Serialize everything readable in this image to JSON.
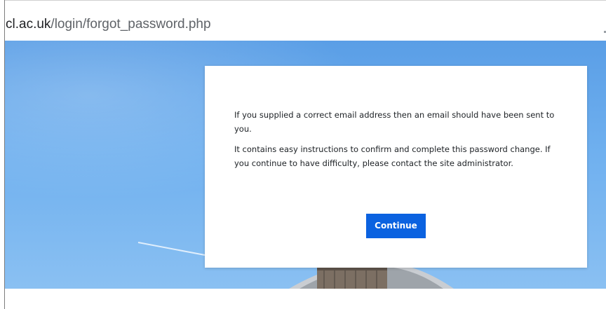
{
  "browser": {
    "url_host": "cl.ac.uk",
    "url_path": "/login/forgot_password.php"
  },
  "modal": {
    "paragraph_1": "If you supplied a correct email address then an email should have been sent to you.",
    "paragraph_2": "It contains easy instructions to confirm and complete this password change. If you continue to have difficulty, please contact the site administrator.",
    "continue_label": "Continue"
  },
  "colors": {
    "button": "#0b62e0",
    "sky": "#6fb0ef"
  }
}
